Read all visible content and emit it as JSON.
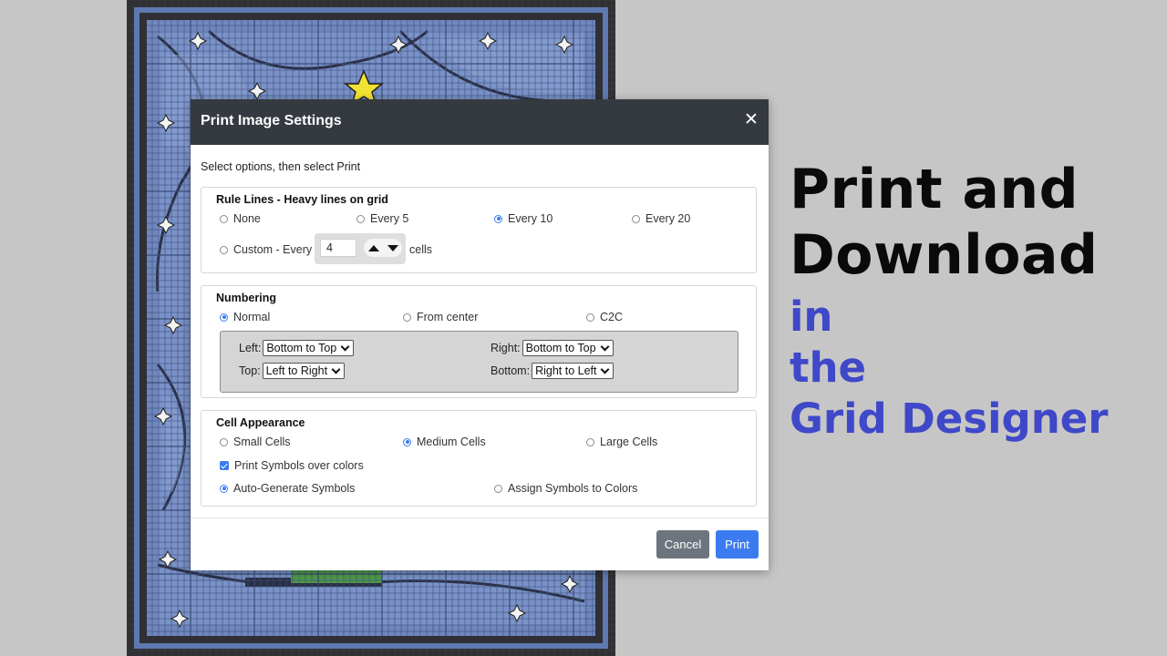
{
  "background": {
    "grid_colors": {
      "border_dark": "#2f2f34",
      "frame_blue": "#5f79b0",
      "panel_blue": "#6f87bd",
      "light_blue": "#8aa2d2",
      "cell_line": "#3d4f7d",
      "star_yellow": "#f2e233",
      "star_white": "#f4f4f4",
      "stem_green": "#4f9a4a"
    }
  },
  "promo": {
    "line1": "Print and",
    "line2": "Download",
    "line3": "in",
    "line4": "the",
    "line5": "Grid Designer",
    "black": "#0a0a0a",
    "blue": "#3f48c8"
  },
  "modal": {
    "title": "Print Image Settings",
    "close_icon": "close-x-icon",
    "intro": "Select options, then select Print",
    "rule_lines": {
      "title": "Rule Lines - Heavy lines on grid",
      "options": [
        "None",
        "Every 5",
        "Every 10",
        "Every 20"
      ],
      "selected": "Every 10",
      "custom_label": "Custom - Every",
      "custom_value": "4",
      "custom_suffix": "cells"
    },
    "numbering": {
      "title": "Numbering",
      "options": [
        "Normal",
        "From center",
        "C2C"
      ],
      "selected": "Normal",
      "left_label": "Left:",
      "left_value": "Bottom to Top",
      "right_label": "Right:",
      "right_value": "Bottom to Top",
      "top_label": "Top:",
      "top_value": "Left to Right",
      "bottom_label": "Bottom:",
      "bottom_value": "Right to Left"
    },
    "cell_appearance": {
      "title": "Cell Appearance",
      "sizes": [
        "Small Cells",
        "Medium Cells",
        "Large Cells"
      ],
      "selected_size": "Medium Cells",
      "print_symbols_label": "Print Symbols over colors",
      "print_symbols_checked": true,
      "symbol_modes": [
        "Auto-Generate Symbols",
        "Assign Symbols to Colors"
      ],
      "selected_symbol_mode": "Auto-Generate Symbols"
    },
    "buttons": {
      "cancel": "Cancel",
      "print": "Print"
    },
    "accent": "#3b7bf0",
    "header_bg": "#343a40"
  }
}
